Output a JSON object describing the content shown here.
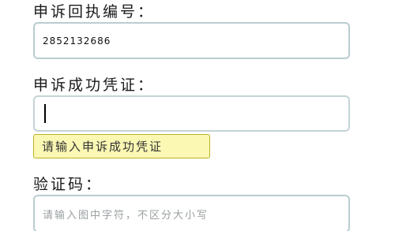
{
  "form": {
    "receipt_label": "申诉回执编号：",
    "receipt_value": "2852132686",
    "proof_label": "申诉成功凭证：",
    "proof_value": "",
    "proof_hint": "请输入申诉成功凭证",
    "captcha_label": "验证码：",
    "captcha_placeholder": "请输入图中字符，不区分大小写"
  }
}
